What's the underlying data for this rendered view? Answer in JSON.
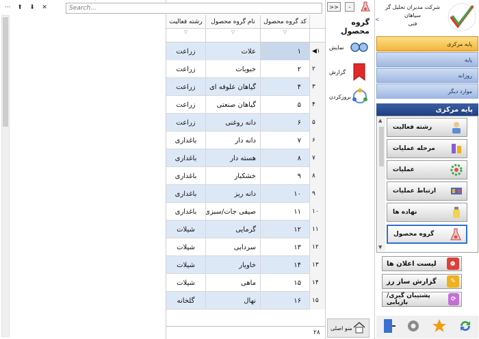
{
  "toolbar": {
    "menu_icon": "ellipsis-icon",
    "up_icon": "arrow-up-icon",
    "down_icon": "arrow-down-icon",
    "close_icon": "close-icon",
    "search_placeholder": "Search..."
  },
  "grid": {
    "headers": {
      "code": "کد گروه محصول",
      "name": "نام گروه محصول",
      "activity": "رشته فعالیت"
    },
    "rows": [
      {
        "n": "۱",
        "code": "۱",
        "name": "علات",
        "act": "زراعت"
      },
      {
        "n": "۲",
        "code": "۲",
        "name": "حبوبات",
        "act": "زراعت"
      },
      {
        "n": "۳",
        "code": "۴",
        "name": "گیاهان علوفه ای",
        "act": "زراعت"
      },
      {
        "n": "۴",
        "code": "۵",
        "name": "گیاهان صنعتی",
        "act": "زراعت"
      },
      {
        "n": "۵",
        "code": "۶",
        "name": "دانه روغنی",
        "act": "زراعت"
      },
      {
        "n": "۶",
        "code": "۷",
        "name": "دانه دار",
        "act": "باغداری"
      },
      {
        "n": "۷",
        "code": "۸",
        "name": "هسته دار",
        "act": "باغداری"
      },
      {
        "n": "۸",
        "code": "۹",
        "name": "خشکبار",
        "act": "باغداری"
      },
      {
        "n": "۹",
        "code": "۱۰",
        "name": "دانه ریز",
        "act": "باغداری"
      },
      {
        "n": "۱۰",
        "code": "۱۱",
        "name": "صیفی جات/سبزی",
        "act": "باغداری"
      },
      {
        "n": "۱۱",
        "code": "۱۲",
        "name": "گرمایی",
        "act": "شیلات"
      },
      {
        "n": "۱۲",
        "code": "۱۳",
        "name": "سردابی",
        "act": "شیلات"
      },
      {
        "n": "۱۳",
        "code": "۱۴",
        "name": "خاویار",
        "act": "شیلات"
      },
      {
        "n": "۱۴",
        "code": "۱۵",
        "name": "ماهی",
        "act": "شیلات"
      },
      {
        "n": "۱۵",
        "code": "۱۶",
        "name": "نهال",
        "act": "گلخانه"
      }
    ],
    "footer_count": "۲۸"
  },
  "mid": {
    "btn_expand": ">>",
    "btn_minus": "-",
    "title": "گروه محصول",
    "actions": [
      {
        "label": "نمایش",
        "icon": "glasses-icon"
      },
      {
        "label": "گزارش",
        "icon": "bookmark-icon"
      },
      {
        "label": "بروزکردن",
        "icon": "refresh-icon"
      }
    ],
    "home_label": "منو اصلی"
  },
  "side": {
    "collapse": "<",
    "company_line1": "شرکت مدیران تحلیل گر",
    "company_line2": "سیاهان",
    "company_line3": "فنی",
    "tabs": [
      "پایه مرکزی",
      "پایه",
      "روزانه",
      "موارد دیگر"
    ],
    "section_title": "پایه مرکزی",
    "list_items": [
      {
        "label": "رشته فعالیت",
        "icon": "person-icon"
      },
      {
        "label": "مرحله عملیات",
        "icon": "tools-icon"
      },
      {
        "label": "عملیات",
        "icon": "gear-icon"
      },
      {
        "label": "ارتباط عملیات",
        "icon": "link-icon"
      },
      {
        "label": "نهاده ها",
        "icon": "bottle-icon"
      },
      {
        "label": "گروه محصول",
        "icon": "flask-icon"
      }
    ],
    "big_buttons": [
      {
        "label": "لیست اعلان ها",
        "icon": "alarm-icon",
        "color": "#e0403a"
      },
      {
        "label": "گزارش ساز رز",
        "icon": "report-icon",
        "color": "#f0b020"
      },
      {
        "label": "پشتیبان گیری/ بازیابی",
        "icon": "backup-icon",
        "color": "#c270d8"
      }
    ],
    "bottom_icons": [
      "refresh-green-icon",
      "star-icon",
      "settings-icon",
      "exit-icon"
    ]
  }
}
